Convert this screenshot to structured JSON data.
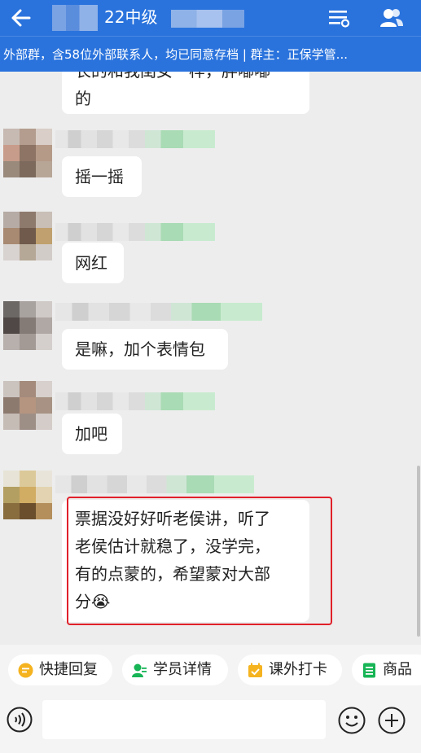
{
  "header": {
    "back_icon": "back-arrow-icon",
    "title": "22中级",
    "menu_icon": "list-settings-icon",
    "group_icon": "group-members-icon"
  },
  "subbar": {
    "text": "外部群，含58位外部联系人，均已同意存档 | 群主：正保学管..."
  },
  "messages": [
    {
      "text_lines": [
        "长的和我闺女一样，胖嘟嘟",
        "的"
      ]
    },
    {
      "text": "摇一摇"
    },
    {
      "text": "网红"
    },
    {
      "text": "是嘛，加个表情包"
    },
    {
      "text": "加吧"
    },
    {
      "text_lines": [
        "票据没好好听老侯讲，听了",
        "老侯估计就稳了，没学完，",
        "有的点蒙的，希望蒙对大部",
        "分"
      ],
      "emoji": "😭"
    }
  ],
  "quick_actions": [
    {
      "label": "快捷回复",
      "icon": "chat-bubble-icon",
      "color": "#f5b320"
    },
    {
      "label": "学员详情",
      "icon": "person-icon",
      "color": "#17b556"
    },
    {
      "label": "课外打卡",
      "icon": "calendar-check-icon",
      "color": "#f5b320"
    },
    {
      "label": "商品",
      "icon": "list-icon",
      "color": "#17b556"
    }
  ],
  "input_bar": {
    "voice_icon": "voice-icon",
    "emoji_icon": "emoji-icon",
    "plus_icon": "plus-icon",
    "placeholder": ""
  },
  "colors": {
    "header_bg": "#2a73dd",
    "highlight_border": "#e0202a"
  }
}
